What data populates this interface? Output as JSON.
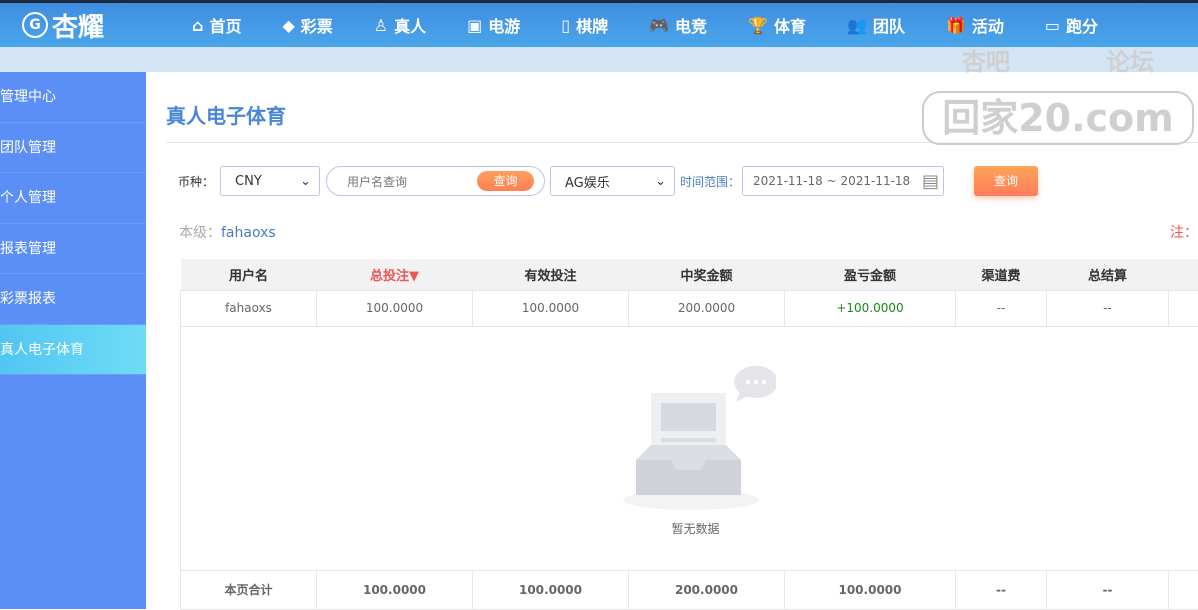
{
  "header": {
    "logo": "杏耀",
    "nav": [
      {
        "label": "首页",
        "icon": "home-icon",
        "g": "⌂"
      },
      {
        "label": "彩票",
        "icon": "ticket-icon",
        "g": "◆"
      },
      {
        "label": "真人",
        "icon": "dealer-icon",
        "g": "♙"
      },
      {
        "label": "电游",
        "icon": "slot-machine-icon",
        "g": "▣"
      },
      {
        "label": "棋牌",
        "icon": "cards-icon",
        "g": "▯"
      },
      {
        "label": "电竞",
        "icon": "gamepad-icon",
        "g": "🎮"
      },
      {
        "label": "体育",
        "icon": "trophy-icon",
        "g": "🏆"
      },
      {
        "label": "团队",
        "icon": "team-icon",
        "g": "👥"
      },
      {
        "label": "活动",
        "icon": "gift-icon",
        "g": "🎁"
      },
      {
        "label": "跑分",
        "icon": "truck-icon",
        "g": "▭"
      }
    ]
  },
  "sidebar": {
    "items": [
      "管理中心",
      "团队管理",
      "个人管理",
      "报表管理",
      "彩票报表",
      "真人电子体育"
    ]
  },
  "page": {
    "title": "真人电子体育"
  },
  "filters": {
    "currency_label": "币种：",
    "currency": "CNY",
    "username_placeholder": "用户名查询",
    "search_btn": "查询",
    "platform": "AG娱乐",
    "time_label": "时间范围：",
    "date_range": "2021-11-18 ~ 2021-11-18",
    "query_btn": "查询"
  },
  "level": {
    "label": "本级：",
    "user": "fahaoxs"
  },
  "note": "注：",
  "table": {
    "headers": [
      "用户名",
      "总投注▼",
      "有效投注",
      "中奖金额",
      "盈亏金额",
      "渠道费",
      "总结算",
      ""
    ],
    "row": [
      "fahaoxs",
      "100.0000",
      "100.0000",
      "200.0000",
      "+100.0000",
      "--",
      "--",
      ""
    ],
    "empty_text": "暂无数据",
    "footer": [
      "本页合计",
      "100.0000",
      "100.0000",
      "200.0000",
      "100.0000",
      "--",
      "--",
      ""
    ]
  },
  "watermark": {
    "line1a": "杏吧",
    "line1b": "论坛",
    "line2": "回家20.com"
  }
}
